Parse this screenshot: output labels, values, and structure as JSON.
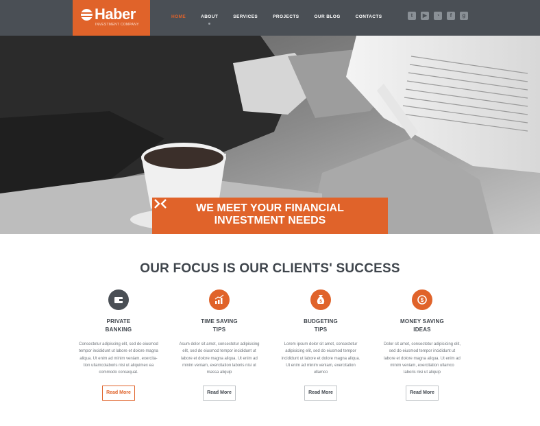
{
  "logo": {
    "name": "Haber",
    "tagline": "INVESTMENT COMPANY"
  },
  "nav": [
    {
      "label": "HOME",
      "active": true
    },
    {
      "label": "ABOUT",
      "active": false
    },
    {
      "label": "SERVICES",
      "active": false
    },
    {
      "label": "PROJECTS",
      "active": false
    },
    {
      "label": "OUR BLOG",
      "active": false
    },
    {
      "label": "CONTACTS",
      "active": false
    }
  ],
  "social": [
    "twitter-icon",
    "youtube-icon",
    "rss-icon",
    "facebook-icon",
    "google-plus-icon"
  ],
  "hero": {
    "title_line1": "WE MEET YOUR FINANCIAL",
    "title_line2": "INVESTMENT NEEDS"
  },
  "focus": {
    "title": "OUR FOCUS IS OUR CLIENTS' SUCCESS",
    "features": [
      {
        "icon": "wallet-icon",
        "icon_color": "#4a4f55",
        "title_line1": "PRIVATE",
        "title_line2": "BANKING",
        "body": [
          "Consectetur adipiscing elit, sed do eiusmod",
          "tempor incididunt ut labore et dolore magna",
          "aliqua. Ut enim ad minim veniam, exercita-",
          "tion ullamcolaboris nisi ut aliquimex ea",
          "commodo consequat."
        ],
        "button": "Read More"
      },
      {
        "icon": "chart-icon",
        "icon_color": "#e0632a",
        "title_line1": "TIME SAVING",
        "title_line2": "TIPS",
        "body": [
          "Asum dolor sit amet, consectetur adipisicing",
          "elit, sed do eiusmod tempor incididunt ut",
          "labore et dolore magna aliqua. Ut enim ad",
          "minim veniam, exercitation laboris nisi ut",
          "massa aliquip"
        ],
        "button": "Read More"
      },
      {
        "icon": "money-bag-icon",
        "icon_color": "#e0632a",
        "title_line1": "BUDGETING",
        "title_line2": "TIPS",
        "body": [
          "Lorem ipsum dolor sit amet, consectetur",
          "adipisicing elit, sed do eiusmod tempor",
          "incididunt ut labore et dolore magna aliqua.",
          "Ut enim ad minim veniam, exercitation",
          "ullamco"
        ],
        "button": "Read More"
      },
      {
        "icon": "dollar-coin-icon",
        "icon_color": "#e0632a",
        "title_line1": "MONEY SAVING",
        "title_line2": "IDEAS",
        "body": [
          "Dolor sit amet, consectetur adipisicing elit,",
          "sed do eiusmod tempor incididunt ut",
          "labore et dolore magna aliqua. Ut enim ad",
          "minim veniam, exercitation ullamco",
          "laboris nisi ut aliquip"
        ],
        "button": "Read More"
      }
    ]
  },
  "colors": {
    "accent": "#e0632a",
    "header": "#4a4f55",
    "text": "#3f454c"
  }
}
